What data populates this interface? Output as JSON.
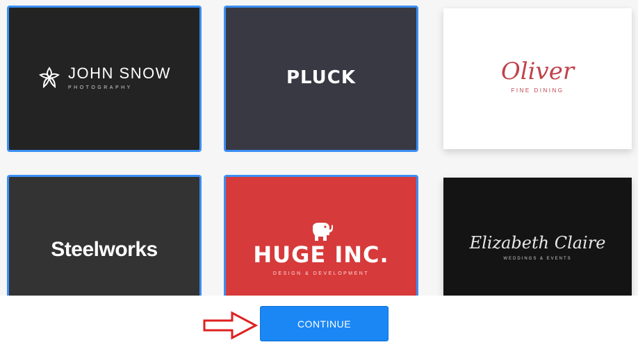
{
  "cards": [
    {
      "title": "JOHN SNOW",
      "subtitle": "PHOTOGRAPHY",
      "selected": true,
      "icon": "flower-icon"
    },
    {
      "title": "PLUCK",
      "selected": true
    },
    {
      "title": "Oliver",
      "subtitle": "FINE DINING",
      "selected": false
    },
    {
      "title": "Steelworks",
      "selected": true
    },
    {
      "title": "HUGE INC.",
      "subtitle": "DESIGN & DEVELOPMENT",
      "selected": true,
      "icon": "elephant-icon"
    },
    {
      "title": "Elizabeth Claire",
      "subtitle": "WEDDINGS & EVENTS",
      "selected": false
    }
  ],
  "footer": {
    "continue_label": "CONTINUE",
    "annotation": "red-arrow-icon"
  },
  "colors": {
    "selected_border": "#3b8ff4",
    "button": "#1a87f5",
    "arrow": "#e02020",
    "huge_bg": "#d63a3a",
    "oliver_text": "#c0424c"
  }
}
